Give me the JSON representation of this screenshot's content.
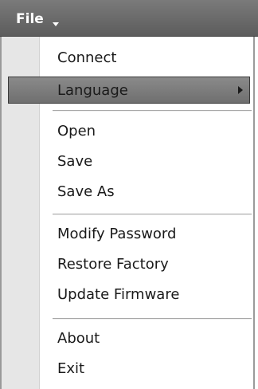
{
  "menubar": {
    "file_label": "File"
  },
  "menu": {
    "items": [
      {
        "label": "Connect"
      },
      {
        "label": "Language",
        "highlighted": true,
        "has_submenu": true
      },
      {
        "label": "Open"
      },
      {
        "label": "Save"
      },
      {
        "label": "Save As"
      },
      {
        "label": "Modify Password"
      },
      {
        "label": "Restore Factory"
      },
      {
        "label": "Update Firmware"
      },
      {
        "label": "About"
      },
      {
        "label": "Exit"
      }
    ]
  },
  "colors": {
    "menubar": "#6a6a6a",
    "highlight": "#7d7d7d",
    "gutter": "#e6e6e6",
    "text": "#1a1a1a"
  }
}
